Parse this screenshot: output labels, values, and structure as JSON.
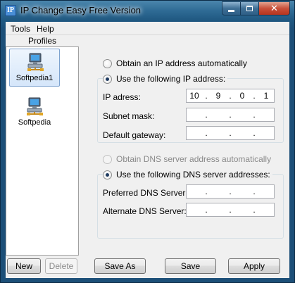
{
  "window": {
    "title": "IP Change Easy Free Version"
  },
  "menu": {
    "tools": "Tools",
    "help": "Help"
  },
  "profiles": {
    "header": "Profiles",
    "items": [
      {
        "label": "Softpedia1",
        "selected": true
      },
      {
        "label": "Softpedia",
        "selected": false
      }
    ],
    "new_button": "New",
    "delete_button": "Delete"
  },
  "ip": {
    "auto_label": "Obtain an IP address automatically",
    "manual_label": "Use the following IP address:",
    "ip_label": "IP adress:",
    "ip_value": [
      "10",
      "9",
      "0",
      "1"
    ],
    "subnet_label": "Subnet mask:",
    "gateway_label": "Default gateway:"
  },
  "dns": {
    "auto_label": "Obtain DNS server address automatically",
    "manual_label": "Use the following DNS server addresses:",
    "preferred_label": "Preferred DNS Server:",
    "alternate_label": "Alternate DNS Server:"
  },
  "actions": {
    "save_as": "Save As",
    "save": "Save",
    "apply": "Apply"
  },
  "colors": {
    "selection": "#d5e6fa",
    "title_bg": "#1c4f78",
    "close_btn": "#c9503a"
  },
  "icons": {
    "profile": "network-computer-icon",
    "app": "ip-app-icon"
  }
}
